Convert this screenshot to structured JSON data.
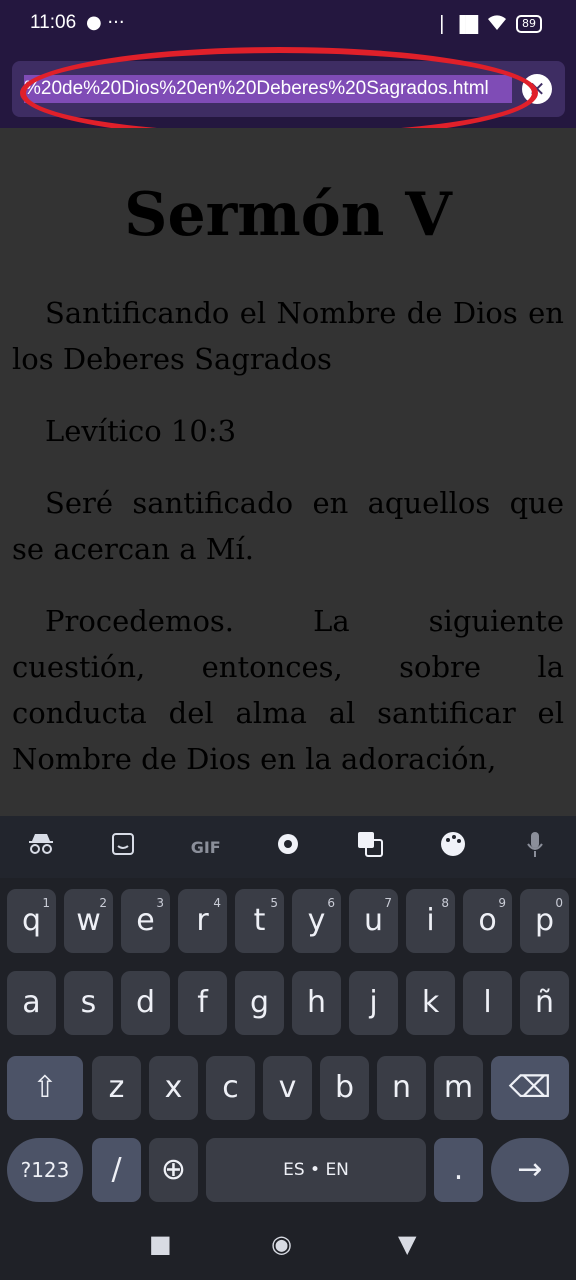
{
  "status": {
    "time": "11:06",
    "left_icons": "● ···",
    "signal": "▏▐█",
    "battery": "89"
  },
  "browser": {
    "url": "%20de%20Dios%20en%20Deberes%20Sagrados.html",
    "clear": "✕"
  },
  "document": {
    "title": "Sermón V",
    "paragraphs": [
      "Santificando el Nombre de Dios en los Deberes Sagrados",
      "Levítico 10:3",
      "Seré santificado en aquellos que se acercan a Mí.",
      "Procedemos. La siguiente cuestión, entonces, sobre la conducta del alma al santificar el Nombre de Dios en la adoración,"
    ]
  },
  "keyboard": {
    "toolbar": [
      "incognito-icon",
      "sticker-icon",
      "GIF",
      "settings-icon",
      "translate-icon",
      "palette-icon",
      "mic-icon"
    ],
    "toolbar_gif": "GIF",
    "row1": [
      "q",
      "w",
      "e",
      "r",
      "t",
      "y",
      "u",
      "i",
      "o",
      "p"
    ],
    "row1_hints": [
      "1",
      "2",
      "3",
      "4",
      "5",
      "6",
      "7",
      "8",
      "9",
      "0"
    ],
    "row2": [
      "a",
      "s",
      "d",
      "f",
      "g",
      "h",
      "j",
      "k",
      "l",
      "ñ"
    ],
    "row3": [
      "z",
      "x",
      "c",
      "v",
      "b",
      "n",
      "m"
    ],
    "shift": "⇧",
    "backspace": "⌫",
    "symbols": "?123",
    "slash": "/",
    "globe": "⊕",
    "space": "ES • EN",
    "period": ".",
    "enter": "→"
  },
  "nav": {
    "recents": "■",
    "home": "◉",
    "back": "▼"
  },
  "colors": {
    "annotation": "#e0202a",
    "accent": "#7f4cb6"
  }
}
